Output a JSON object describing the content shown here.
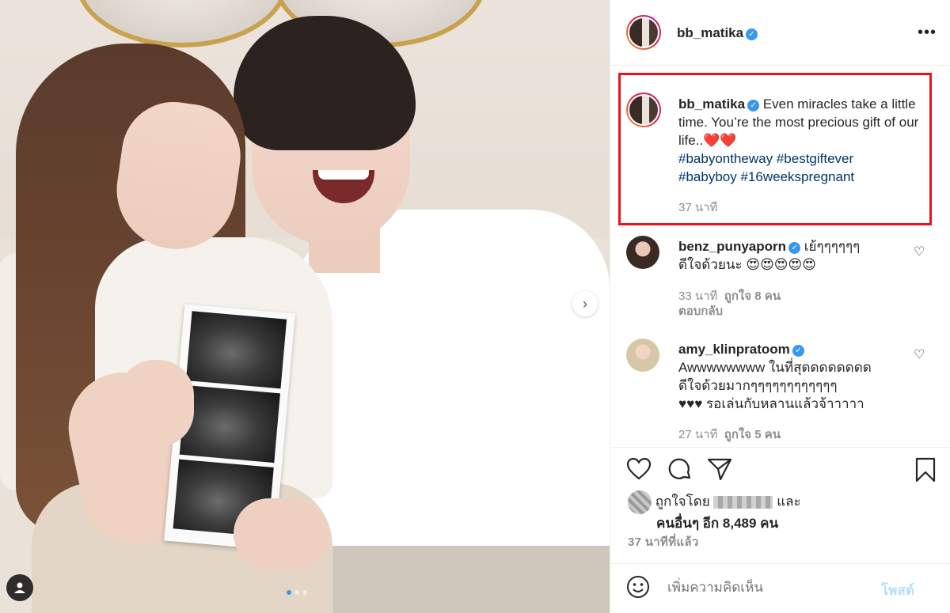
{
  "post": {
    "author": "bb_matika",
    "author_verified": true,
    "caption": {
      "text": "Even miracles take a little time. You’re the most precious gift of our life..",
      "emoji": "❤️❤️",
      "hashtags": [
        "#babyontheway",
        "#bestgiftever",
        "#babyboy",
        "#16weekspregnant"
      ],
      "time": "37 นาที"
    },
    "comments": [
      {
        "username": "benz_punyaporn",
        "verified": true,
        "text_line1": "เย้ๆๆๆๆๆๆ",
        "text_line2": "ดีใจด้วยนะ",
        "emoji": "😍😍😍😍😍",
        "time": "33 นาที",
        "likes": "ถูกใจ 8 คน",
        "reply": "ตอบกลับ"
      },
      {
        "username": "amy_klinpratoom",
        "verified": true,
        "text_line1": "Awwwwwwww ในที่สุดดดดดดดด",
        "text_line2": "ดีใจด้วยมากๆๆๆๆๆๆๆๆๆๆๆๆ",
        "text_line3_prefix": "♥♥♥",
        "text_line3": "รอเล่นกับหลานแล้วจ้าาาาา",
        "time": "27 นาที",
        "likes": "ถูกใจ 5 คน"
      }
    ],
    "likes": {
      "liked_by": "ถูกใจโดย",
      "and": "และ",
      "others": "คนอื่นๆ อีก 8,489 คน"
    },
    "timestamp": "37 นาทีที่แล้ว",
    "comment_input": {
      "placeholder": "เพิ่มความคิดเห็น",
      "post_label": "โพสต์"
    },
    "carousel": {
      "slide_count": 3,
      "active_slide": 1
    },
    "colors": {
      "highlight_box": "#e8141b",
      "hashtag": "#003569",
      "verified": "#3897f0",
      "muted": "#8e8e8e"
    },
    "icons": [
      "more-options-icon",
      "verified-icon",
      "like-heart-icon",
      "comment-icon",
      "share-icon",
      "save-bookmark-icon",
      "emoji-icon",
      "next-arrow-icon",
      "user-tag-icon"
    ]
  }
}
